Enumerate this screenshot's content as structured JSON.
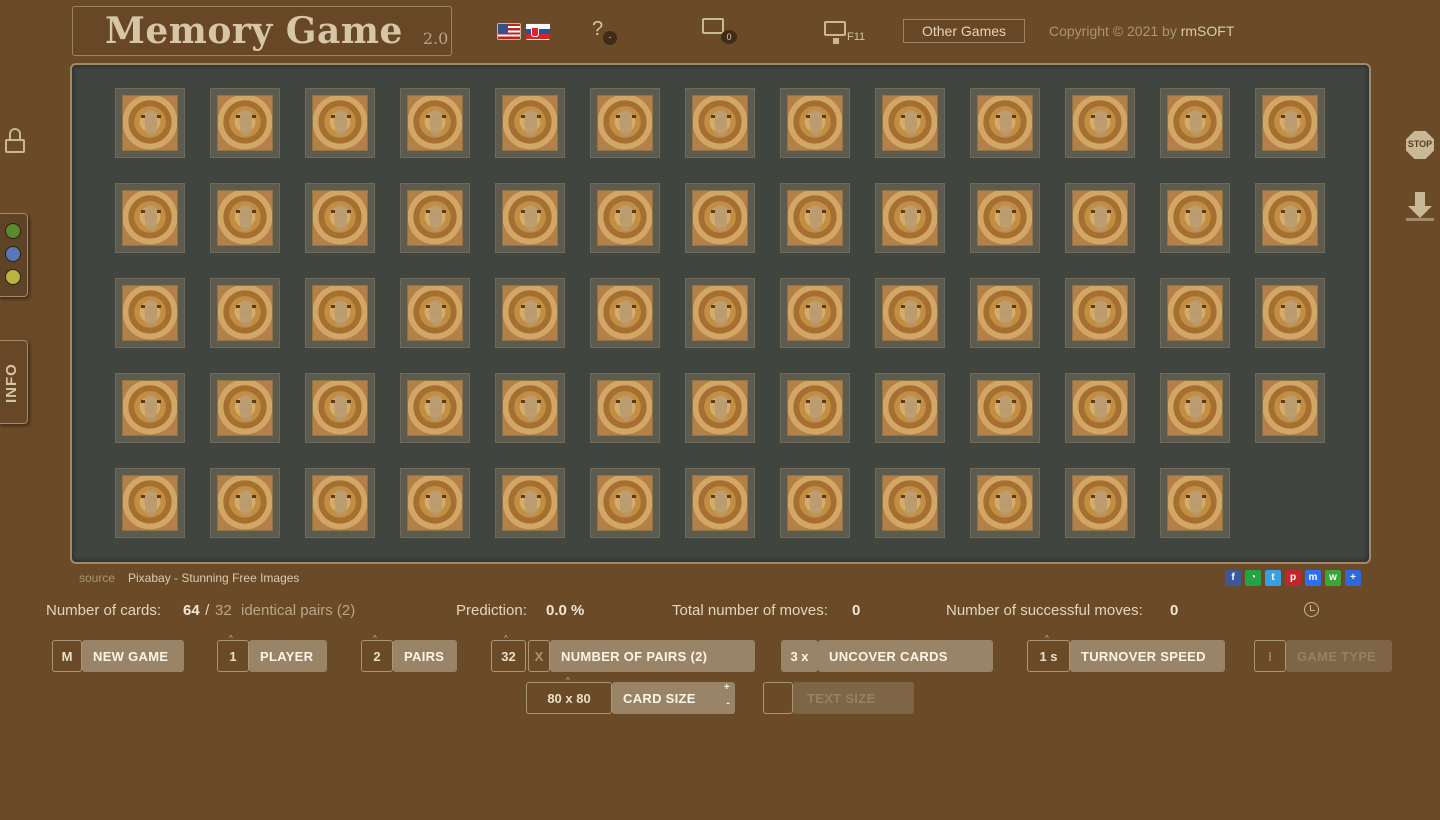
{
  "header": {
    "title": "Memory Game",
    "version": "2.0",
    "help_label": "?",
    "help_badge": "-",
    "keyboard_badge": "0",
    "fullscreen_label": "F11",
    "other_games_label": "Other Games",
    "copyright_prefix": "Copyright © 2021 by",
    "copyright_brand": "rmSOFT",
    "languages": [
      "en-flag-icon",
      "sk-flag-icon"
    ]
  },
  "sidebar_left": {
    "info_label": "INFO",
    "color_options": [
      "#5b8a2e",
      "#5878b8",
      "#b8b440"
    ]
  },
  "sidebar_right": {
    "stop_label": "STOP"
  },
  "board": {
    "card_count": 64,
    "columns": 13,
    "card_back": "lion-card-back",
    "background": "#404540"
  },
  "source": {
    "label": "source",
    "link_text": "Pixabay - Stunning Free Images"
  },
  "share_icons": [
    "facebook-icon",
    "whatsapp-icon",
    "twitter-icon",
    "pinterest-icon",
    "messenger-icon",
    "wechat-icon",
    "more-share-icon"
  ],
  "stats": {
    "cards_label": "Number of cards:",
    "cards_value": "64",
    "cards_sep": " / ",
    "cards_total": "32",
    "pairs_text": "identical pairs (2)",
    "prediction_label": "Prediction:",
    "prediction_value": "0.0 %",
    "total_moves_label": "Total number of moves:",
    "total_moves_value": "0",
    "successful_moves_label": "Number of successful moves:",
    "successful_moves_value": "0"
  },
  "controls": {
    "new_game": {
      "key": "M",
      "label": "NEW GAME"
    },
    "player": {
      "key": "1",
      "label": "PLAYER"
    },
    "pairs": {
      "key": "2",
      "label": "PAIRS"
    },
    "number_of_pairs": {
      "key": "32",
      "key2": "X",
      "label": "NUMBER OF PAIRS (2)"
    },
    "uncover_cards": {
      "key": "3 x",
      "label": "UNCOVER CARDS"
    },
    "turnover_speed": {
      "key": "1 s",
      "label": "TURNOVER SPEED"
    },
    "game_type": {
      "key": "I",
      "label": "GAME TYPE"
    },
    "card_size": {
      "key": "80 x 80",
      "label": "CARD SIZE",
      "plus": "+",
      "minus": "-"
    },
    "text_size": {
      "key": "",
      "label": "TEXT SIZE"
    }
  }
}
